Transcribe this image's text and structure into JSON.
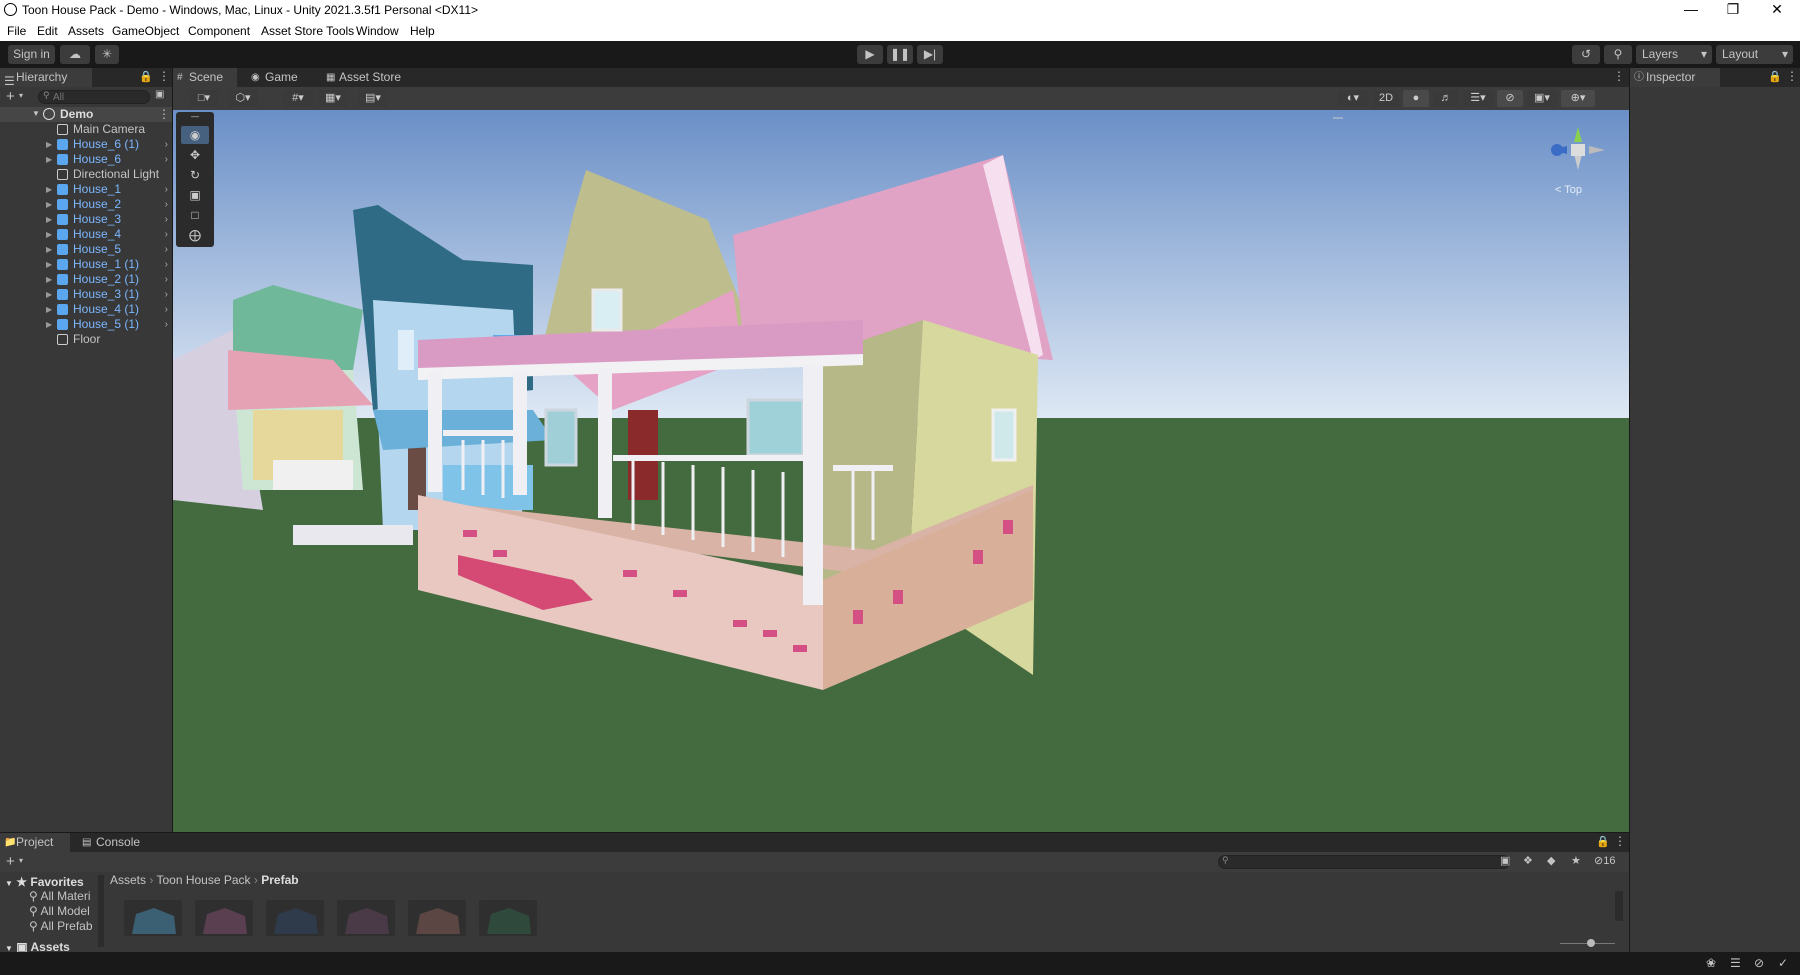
{
  "window": {
    "title": "Toon House Pack - Demo - Windows, Mac, Linux - Unity 2021.3.5f1 Personal <DX11>"
  },
  "menu": [
    "File",
    "Edit",
    "Assets",
    "GameObject",
    "Component",
    "Asset Store Tools",
    "Window",
    "Help"
  ],
  "toolbar": {
    "sign_in": "Sign in",
    "layers": "Layers",
    "layout": "Layout"
  },
  "hierarchy": {
    "tab": "Hierarchy",
    "search_placeholder": "All",
    "root": "Demo",
    "items": [
      {
        "label": "Main Camera",
        "prefab": false,
        "expandable": false
      },
      {
        "label": "House_6 (1)",
        "prefab": true,
        "expandable": true
      },
      {
        "label": "House_6",
        "prefab": true,
        "expandable": true
      },
      {
        "label": "Directional Light",
        "prefab": false,
        "expandable": false
      },
      {
        "label": "House_1",
        "prefab": true,
        "expandable": true
      },
      {
        "label": "House_2",
        "prefab": true,
        "expandable": true
      },
      {
        "label": "House_3",
        "prefab": true,
        "expandable": true
      },
      {
        "label": "House_4",
        "prefab": true,
        "expandable": true
      },
      {
        "label": "House_5",
        "prefab": true,
        "expandable": true
      },
      {
        "label": "House_1 (1)",
        "prefab": true,
        "expandable": true
      },
      {
        "label": "House_2 (1)",
        "prefab": true,
        "expandable": true
      },
      {
        "label": "House_3 (1)",
        "prefab": true,
        "expandable": true
      },
      {
        "label": "House_4 (1)",
        "prefab": true,
        "expandable": true
      },
      {
        "label": "House_5 (1)",
        "prefab": true,
        "expandable": true
      },
      {
        "label": "Floor",
        "prefab": false,
        "expandable": false
      }
    ]
  },
  "scene_tabs": [
    "Scene",
    "Game",
    "Asset Store"
  ],
  "scene": {
    "toggle_2d": "2D",
    "gizmo_label": "< Top",
    "gizmo_axis_y": "y"
  },
  "inspector": {
    "tab": "Inspector"
  },
  "project": {
    "tabs": [
      "Project",
      "Console"
    ],
    "breadcrumb": [
      "Assets",
      "Toon House Pack",
      "Prefab"
    ],
    "favorites": {
      "label": "Favorites",
      "items": [
        "All Materi",
        "All Model",
        "All Prefab"
      ]
    },
    "assets_label": "Assets",
    "hidden_count": "16"
  },
  "colors": {
    "accent": "#4a7cbd",
    "prefab_text": "#7cb7ff",
    "panel": "#383838",
    "sky_top": "#6a8fc7",
    "grass": "#446b3f"
  }
}
